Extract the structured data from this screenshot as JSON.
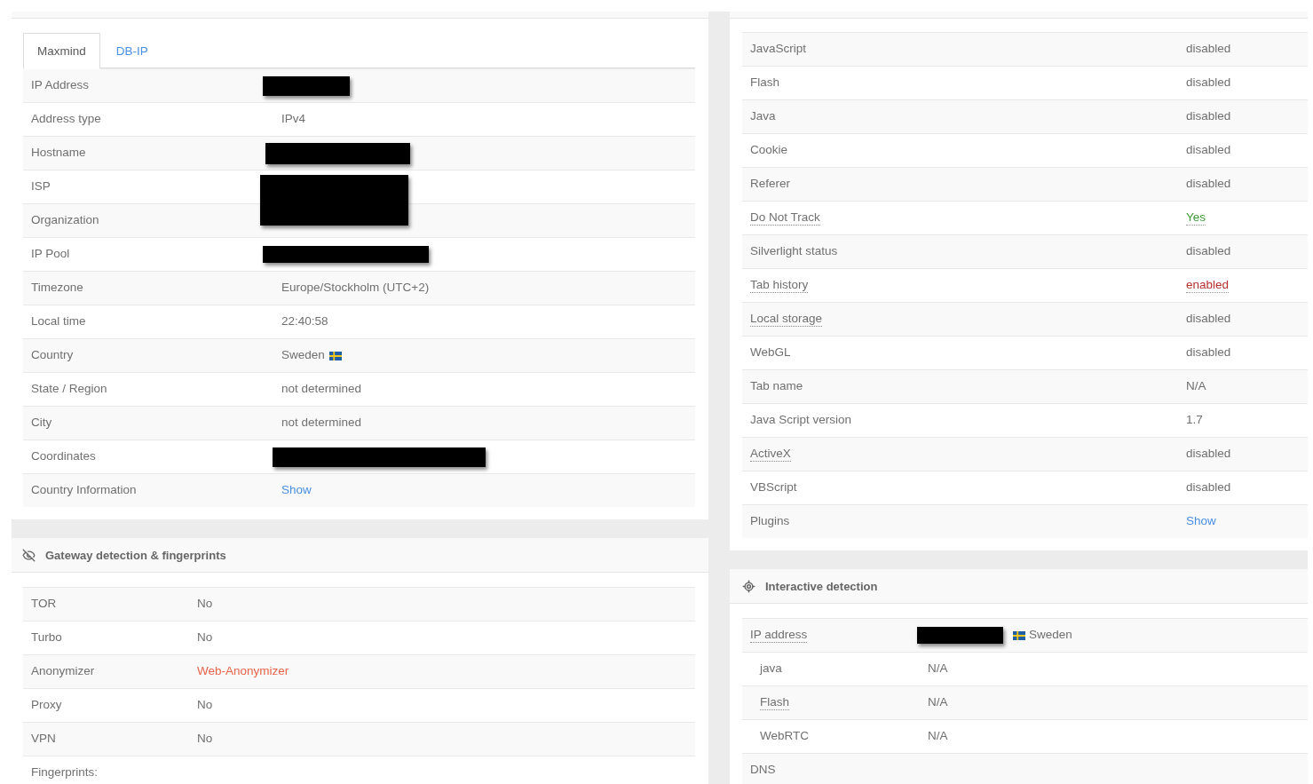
{
  "left_panel": {
    "tabs": [
      {
        "label": "Maxmind",
        "selected": true
      },
      {
        "label": "DB-IP",
        "selected": false
      }
    ],
    "rows": [
      {
        "label": "IP Address",
        "redacted": true
      },
      {
        "label": "Address type",
        "redacted": false,
        "value": "IPv4",
        "kind": "plain"
      },
      {
        "label": "Hostname",
        "redacted": true
      },
      {
        "label": "ISP",
        "redacted": true
      },
      {
        "label": "Organization",
        "redacted": true
      },
      {
        "label": "IP Pool",
        "redacted": true
      },
      {
        "label": "Timezone",
        "redacted": false,
        "value": "Europe/Stockholm (UTC+2)",
        "kind": "plain"
      },
      {
        "label": "Local time",
        "redacted": false,
        "value": "22:40:58",
        "kind": "plain"
      },
      {
        "label": "Country",
        "redacted": false,
        "value": "Sweden",
        "kind": "plain",
        "flag": true
      },
      {
        "label": "State / Region",
        "redacted": false,
        "value": "not determined",
        "kind": "plain"
      },
      {
        "label": "City",
        "redacted": false,
        "value": "not determined",
        "kind": "plain"
      },
      {
        "label": "Coordinates",
        "redacted": true
      },
      {
        "label": "Country Information",
        "redacted": false,
        "value": "Show",
        "kind": "link"
      }
    ]
  },
  "gateway_panel": {
    "title": "Gateway detection & fingerprints",
    "rows": [
      {
        "label": "TOR",
        "value": "No",
        "kind": "plain"
      },
      {
        "label": "Turbo",
        "value": "No",
        "kind": "plain"
      },
      {
        "label": "Anonymizer",
        "value": "Web-Anonymizer",
        "kind": "warning"
      },
      {
        "label": "Proxy",
        "value": "No",
        "kind": "plain"
      },
      {
        "label": "VPN",
        "value": "No",
        "kind": "plain"
      },
      {
        "label": "Fingerprints:"
      }
    ]
  },
  "browser_panel": {
    "rows": [
      {
        "label": "JavaScript",
        "label_tooltip": false,
        "value": "disabled",
        "value_tooltip": false,
        "kind": "plain"
      },
      {
        "label": "Flash",
        "label_tooltip": false,
        "value": "disabled",
        "value_tooltip": false,
        "kind": "plain"
      },
      {
        "label": "Java",
        "label_tooltip": false,
        "value": "disabled",
        "value_tooltip": false,
        "kind": "plain"
      },
      {
        "label": "Cookie",
        "label_tooltip": false,
        "value": "disabled",
        "value_tooltip": false,
        "kind": "plain"
      },
      {
        "label": "Referer",
        "label_tooltip": false,
        "value": "disabled",
        "value_tooltip": false,
        "kind": "plain"
      },
      {
        "label": "Do Not Track",
        "label_tooltip": true,
        "value": "Yes",
        "value_tooltip": true,
        "kind": "positive"
      },
      {
        "label": "Silverlight status",
        "label_tooltip": false,
        "value": "disabled",
        "value_tooltip": false,
        "kind": "plain"
      },
      {
        "label": "Tab history",
        "label_tooltip": true,
        "value": "enabled",
        "value_tooltip": true,
        "kind": "negative"
      },
      {
        "label": "Local storage",
        "label_tooltip": true,
        "value": "disabled",
        "value_tooltip": false,
        "kind": "plain"
      },
      {
        "label": "WebGL",
        "label_tooltip": false,
        "value": "disabled",
        "value_tooltip": false,
        "kind": "plain"
      },
      {
        "label": "Tab name",
        "label_tooltip": false,
        "value": "N/A",
        "value_tooltip": false,
        "kind": "plain"
      },
      {
        "label": "Java Script version",
        "label_tooltip": false,
        "value": "1.7",
        "value_tooltip": false,
        "kind": "plain"
      },
      {
        "label": "ActiveX",
        "label_tooltip": true,
        "value": "disabled",
        "value_tooltip": false,
        "kind": "plain"
      },
      {
        "label": "VBScript",
        "label_tooltip": false,
        "value": "disabled",
        "value_tooltip": false,
        "kind": "plain"
      },
      {
        "label": "Plugins",
        "label_tooltip": false,
        "value": "Show",
        "value_tooltip": false,
        "kind": "link"
      }
    ]
  },
  "interactive_panel": {
    "title": "Interactive detection",
    "rows": [
      {
        "label": "IP address",
        "label_tooltip": true,
        "redacted": true,
        "value": "Sweden",
        "kind": "plain",
        "flag": true,
        "children": [
          {
            "label": "java",
            "label_tooltip": false,
            "redacted": false,
            "value": "N/A",
            "kind": "plain"
          },
          {
            "label": "Flash",
            "label_tooltip": true,
            "redacted": false,
            "value": "N/A",
            "kind": "plain"
          },
          {
            "label": "WebRTC",
            "label_tooltip": false,
            "redacted": false,
            "value": "N/A",
            "kind": "plain"
          }
        ]
      },
      {
        "label": "DNS",
        "label_tooltip": false,
        "redacted": false
      }
    ]
  }
}
